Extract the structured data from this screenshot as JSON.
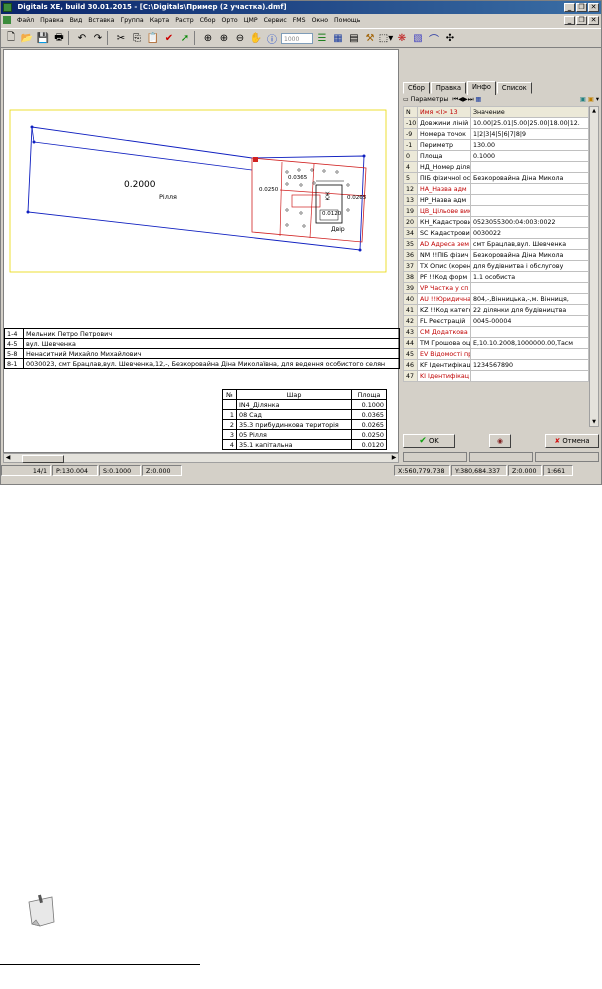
{
  "window": {
    "title": "Digitals XE, build 30.01.2015 - [C:\\Digitals\\Пример (2 участка).dmf]",
    "controls": [
      "_",
      "❐",
      "✕"
    ]
  },
  "menu": [
    "Файл",
    "Правка",
    "Вид",
    "Вставка",
    "Группа",
    "Карта",
    "Растр",
    "Сбор",
    "Орто",
    "ЦМР",
    "Сервис",
    "FMS",
    "Окно",
    "Помощь"
  ],
  "toolbar": {
    "scale_value": "1000"
  },
  "map": {
    "parcel_area": "0.2000",
    "parcel_name": "Рілля",
    "sub_area_1": "0.0365",
    "sub_area_2": "0.0250",
    "sub_area_3": "0.0265",
    "sub_area_4": "0.0120",
    "yard_label": "Двір",
    "house_label": "КЖ"
  },
  "info_rows": [
    {
      "code": "1-4",
      "text": "Мельник Петро Петрович"
    },
    {
      "code": "4-5",
      "text": "вул. Шевченка"
    },
    {
      "code": "5-8",
      "text": "Ненаситний Михайло Михайлович"
    },
    {
      "code": "8-1",
      "text": "0030023, смт Брацлав,вул. Шевченка,12,-, Безкоровайна Діна Миколаївна, для ведення особистого селян"
    }
  ],
  "layers": {
    "headers": [
      "№",
      "Шар",
      "Площа"
    ],
    "rows": [
      {
        "n": "",
        "name": "IN4_Ділянка",
        "area": "0.1000"
      },
      {
        "n": "1",
        "name": "08 Сад",
        "area": "0.0365"
      },
      {
        "n": "2",
        "name": "35.3 прибудинкова територія",
        "area": "0.0265"
      },
      {
        "n": "3",
        "name": "05 Рілля",
        "area": "0.0250"
      },
      {
        "n": "4",
        "name": "35.1 капітальна",
        "area": "0.0120"
      }
    ]
  },
  "panel": {
    "tabs": [
      "Сбор",
      "Правка",
      "Инфо",
      "Список"
    ],
    "active_tab": "Инфо",
    "params_label": "Параметры",
    "headers": {
      "n": "N",
      "name": "Имя <I> 13",
      "value": "Значение"
    },
    "rows": [
      {
        "n": "-10",
        "name": "Довжини ліній",
        "value": "10.00|25.01|5.00|25.00|18.00|12.",
        "red": false
      },
      {
        "n": "-9",
        "name": "Номера точок",
        "value": "1|2|3|4|5|6|7|8|9",
        "red": false
      },
      {
        "n": "-1",
        "name": "Периметр",
        "value": "130.00",
        "red": false
      },
      {
        "n": "0",
        "name": "Площа",
        "value": "0.1000",
        "red": false
      },
      {
        "n": "4",
        "name": "НД_Номер ділян",
        "value": "",
        "red": false
      },
      {
        "n": "5",
        "name": "ПІБ фізичної ос",
        "value": "Безкоровайна Діна Микола",
        "red": false
      },
      {
        "n": "12",
        "name": "НА_Назва адм",
        "value": "",
        "red": true
      },
      {
        "n": "13",
        "name": "НР_Назва адм",
        "value": "",
        "red": false
      },
      {
        "n": "19",
        "name": "ЦВ_Цільове вик",
        "value": "",
        "red": true
      },
      {
        "n": "20",
        "name": "КН_Кадастровий",
        "value": "0523055300:04:003:0022",
        "red": false
      },
      {
        "n": "34",
        "name": "SC Кадастрови",
        "value": "0030022",
        "red": false
      },
      {
        "n": "35",
        "name": "AD Адреса зем",
        "value": "смт Брацлав,вул. Шевченка",
        "red": true
      },
      {
        "n": "36",
        "name": "NM !!ПІБ фізич",
        "value": "Безкоровайна Діна Микола",
        "red": false
      },
      {
        "n": "37",
        "name": "TX Опис (корен",
        "value": "для будівнитва і обслугову",
        "red": false
      },
      {
        "n": "38",
        "name": "PF !!Код форм",
        "value": "1.1 особиста",
        "red": false
      },
      {
        "n": "39",
        "name": "VP Частка у сп",
        "value": "",
        "red": true
      },
      {
        "n": "40",
        "name": "AU !!Юридична",
        "value": "804,-,Вінницька,-,м. Вінниця,",
        "red": true
      },
      {
        "n": "41",
        "name": "KZ !!Код катего",
        "value": "22 ділянки для будівництва",
        "red": false
      },
      {
        "n": "42",
        "name": "FL Реєстрацій",
        "value": "0045-00004",
        "red": false
      },
      {
        "n": "43",
        "name": "CM Додаткова",
        "value": "",
        "red": true
      },
      {
        "n": "44",
        "name": "TM Грошова оц",
        "value": "E,10.10.2008,1000000.00,Тасм",
        "red": false
      },
      {
        "n": "45",
        "name": "EV Відомості пр",
        "value": "",
        "red": true
      },
      {
        "n": "46",
        "name": "KF Ідентифікац",
        "value": "1234567890",
        "red": false
      },
      {
        "n": "47",
        "name": "KI Ідентифікац",
        "value": "",
        "red": true
      }
    ],
    "ok_label": "OK",
    "cancel_label": "Отмена"
  },
  "status": {
    "segment": "14/1",
    "perimeter": "P:130.004",
    "s": "S:0.1000",
    "z": "Z:0.000",
    "x": "X:560,779.738",
    "y": "Y:380,684.337",
    "z2": "Z:0.000",
    "scale": "1:661"
  }
}
